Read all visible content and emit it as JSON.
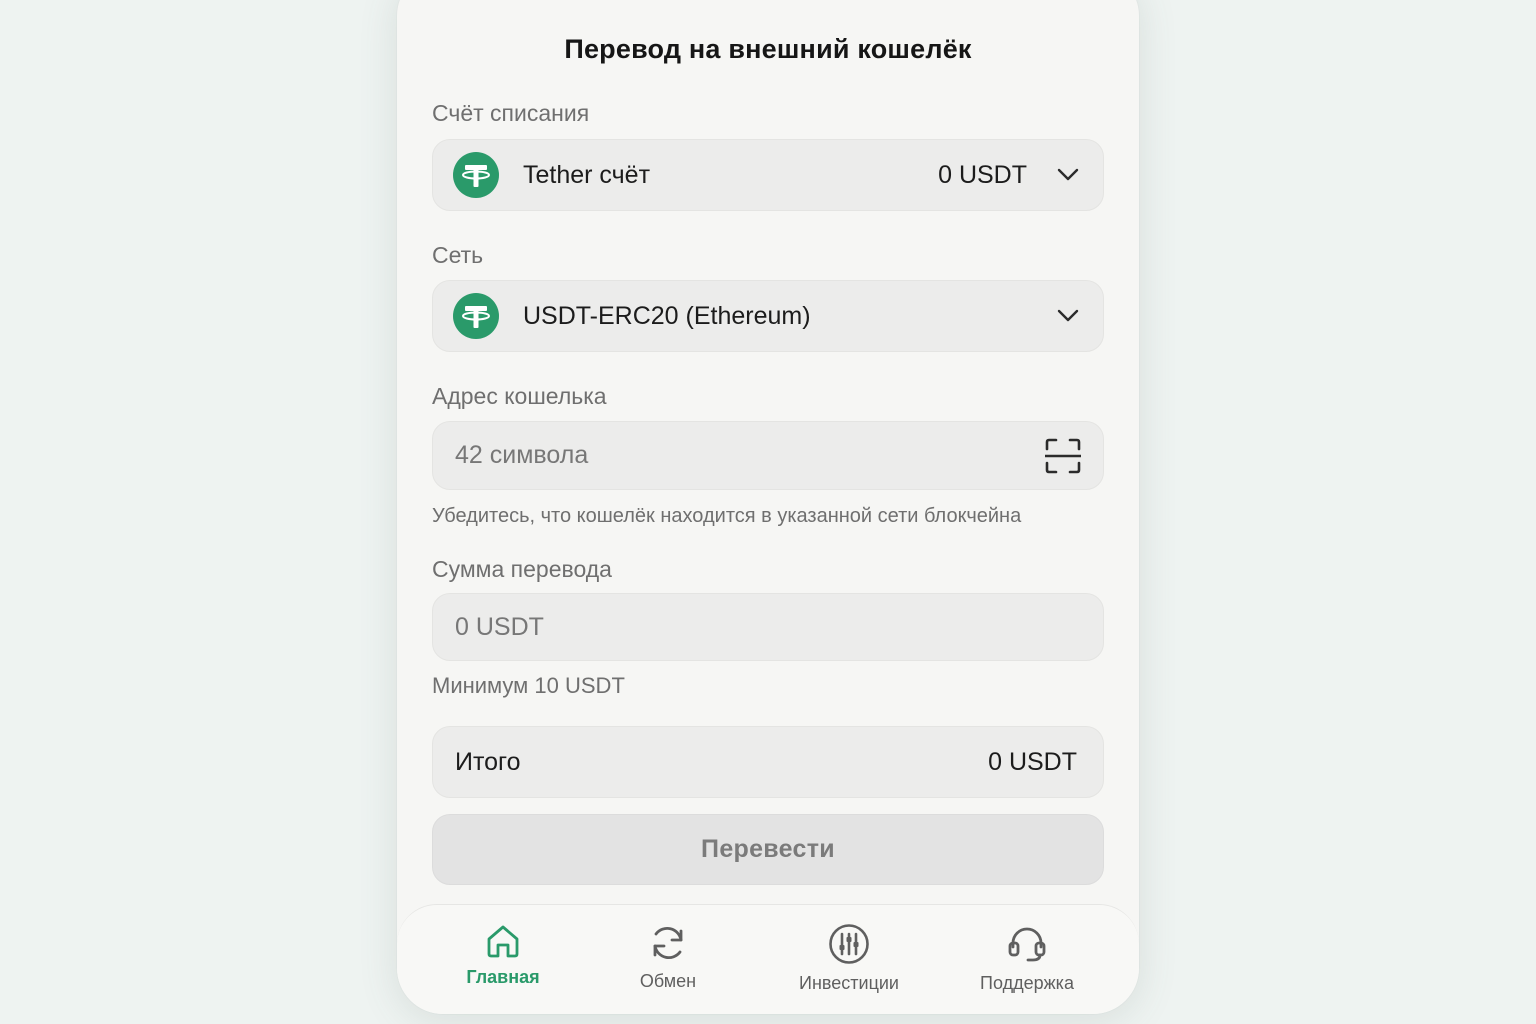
{
  "screen": {
    "title": "Перевод на внешний кошелёк"
  },
  "account": {
    "label": "Счёт списания",
    "name": "Tether счёт",
    "balance": "0 USDT",
    "icon": "tether-icon"
  },
  "network": {
    "label": "Сеть",
    "value": "USDT-ERC20 (Ethereum)",
    "icon": "tether-icon"
  },
  "address": {
    "label": "Адрес кошелька",
    "placeholder": "42 символа",
    "hint": "Убедитесь, что кошелёк находится в указанной сети блокчейна",
    "scan_icon": "scan-qr-icon"
  },
  "amount": {
    "label": "Сумма перевода",
    "placeholder": "0 USDT",
    "hint": "Минимум 10 USDT"
  },
  "total": {
    "label": "Итого",
    "value": "0 USDT"
  },
  "submit": {
    "label": "Перевести"
  },
  "nav": {
    "items": [
      {
        "label": "Главная",
        "icon": "home-icon",
        "active": true
      },
      {
        "label": "Обмен",
        "icon": "exchange-icon",
        "active": false
      },
      {
        "label": "Инвестиции",
        "icon": "sliders-icon",
        "active": false
      },
      {
        "label": "Поддержка",
        "icon": "headset-icon",
        "active": false
      }
    ]
  },
  "colors": {
    "accent": "#2a9a6a",
    "background": "#eef3f1",
    "card": "#f6f6f4"
  }
}
